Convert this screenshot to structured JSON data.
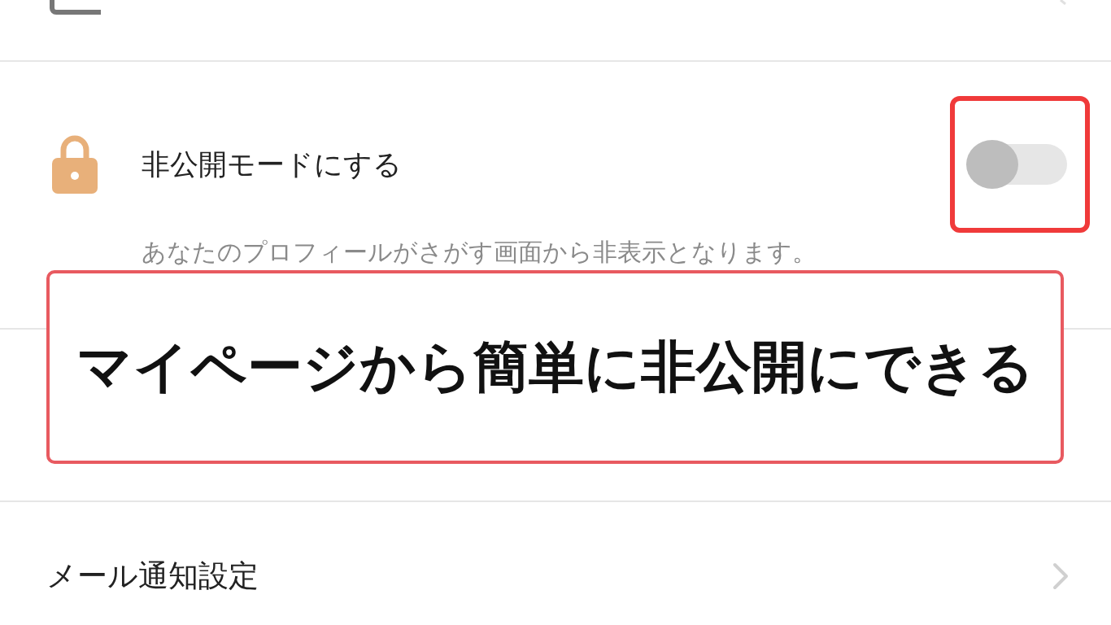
{
  "settings": [
    {
      "kind": "toggle",
      "title": "非公開モードにする",
      "description": "あなたのプロフィールがさがす画面から非表示となります。",
      "on": false
    },
    {
      "kind": "blank"
    },
    {
      "kind": "link",
      "title": "メール通知設定"
    }
  ],
  "annotation": {
    "text": "マイページから簡単に非公開にできる"
  }
}
